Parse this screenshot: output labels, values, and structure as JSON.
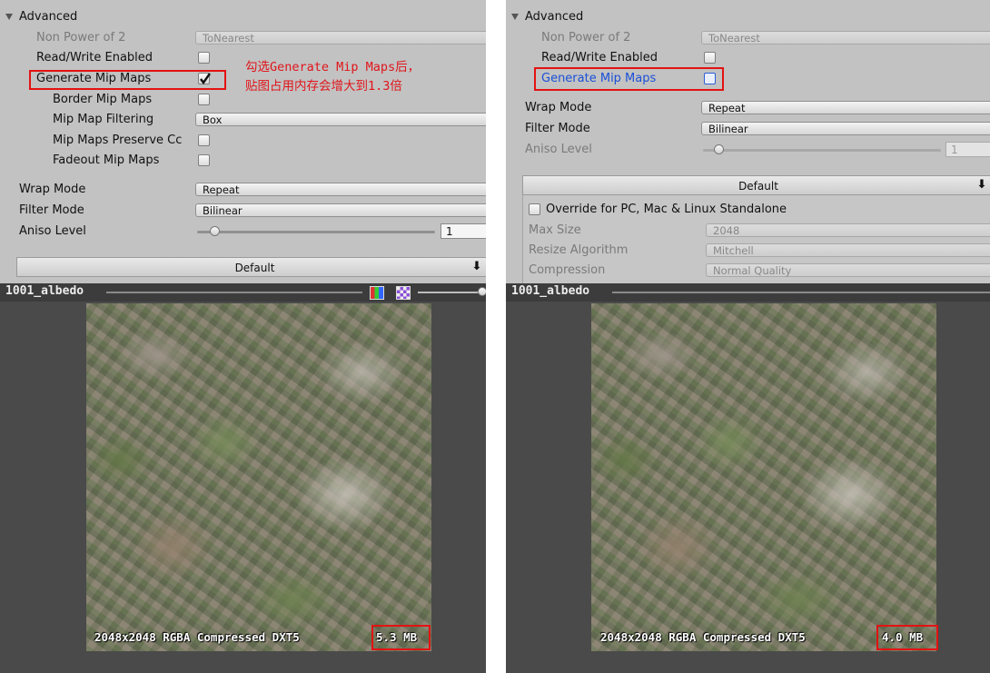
{
  "left": {
    "section_title": "Advanced",
    "non_power_of_2": {
      "label": "Non Power of 2",
      "value": "ToNearest"
    },
    "read_write": {
      "label": "Read/Write Enabled",
      "checked": false
    },
    "generate_mip_maps": {
      "label": "Generate Mip Maps",
      "checked": true
    },
    "border_mip_maps": {
      "label": "Border Mip Maps",
      "checked": false
    },
    "mip_map_filtering": {
      "label": "Mip Map Filtering",
      "value": "Box"
    },
    "mip_maps_preserve": {
      "label": "Mip Maps Preserve Cc",
      "checked": false
    },
    "fadeout_mip_maps": {
      "label": "Fadeout Mip Maps",
      "checked": false
    },
    "wrap_mode": {
      "label": "Wrap Mode",
      "value": "Repeat"
    },
    "filter_mode": {
      "label": "Filter Mode",
      "value": "Bilinear"
    },
    "aniso_level": {
      "label": "Aniso Level",
      "value": "1",
      "level": 1
    },
    "default_tab": "Default",
    "annotation": [
      "勾选Generate Mip Maps后，",
      "贴图占用内存会增大到1.3倍"
    ],
    "preview_title": "1001_albedo",
    "texture_info": "2048x2048  RGBA Compressed DXT5 ",
    "texture_size": "5.3 MB"
  },
  "right": {
    "section_title": "Advanced",
    "non_power_of_2": {
      "label": "Non Power of 2",
      "value": "ToNearest"
    },
    "read_write": {
      "label": "Read/Write Enabled",
      "checked": false
    },
    "generate_mip_maps": {
      "label": "Generate Mip Maps",
      "checked": false
    },
    "wrap_mode": {
      "label": "Wrap Mode",
      "value": "Repeat"
    },
    "filter_mode": {
      "label": "Filter Mode",
      "value": "Bilinear"
    },
    "aniso_level": {
      "label": "Aniso Level",
      "value": "1",
      "level": 1
    },
    "default_tab": "Default",
    "override": {
      "label": "Override for PC, Mac & Linux Standalone",
      "checked": false
    },
    "max_size": {
      "label": "Max Size",
      "value": "2048"
    },
    "resize_algorithm": {
      "label": "Resize Algorithm",
      "value": "Mitchell"
    },
    "compression": {
      "label": "Compression",
      "value": "Normal Quality"
    },
    "preview_title": "1001_albedo",
    "texture_info": "2048x2048  RGBA Compressed DXT5 ",
    "texture_size": "4.0 MB"
  },
  "colors": {
    "highlight_red": "#e31212",
    "annotation_red": "#e0141a",
    "active_blue": "#1a4fd8"
  },
  "icons": [
    "triangle-down-icon",
    "checkmark-icon",
    "download-icon",
    "color-channel-icon",
    "alpha-channel-icon"
  ]
}
